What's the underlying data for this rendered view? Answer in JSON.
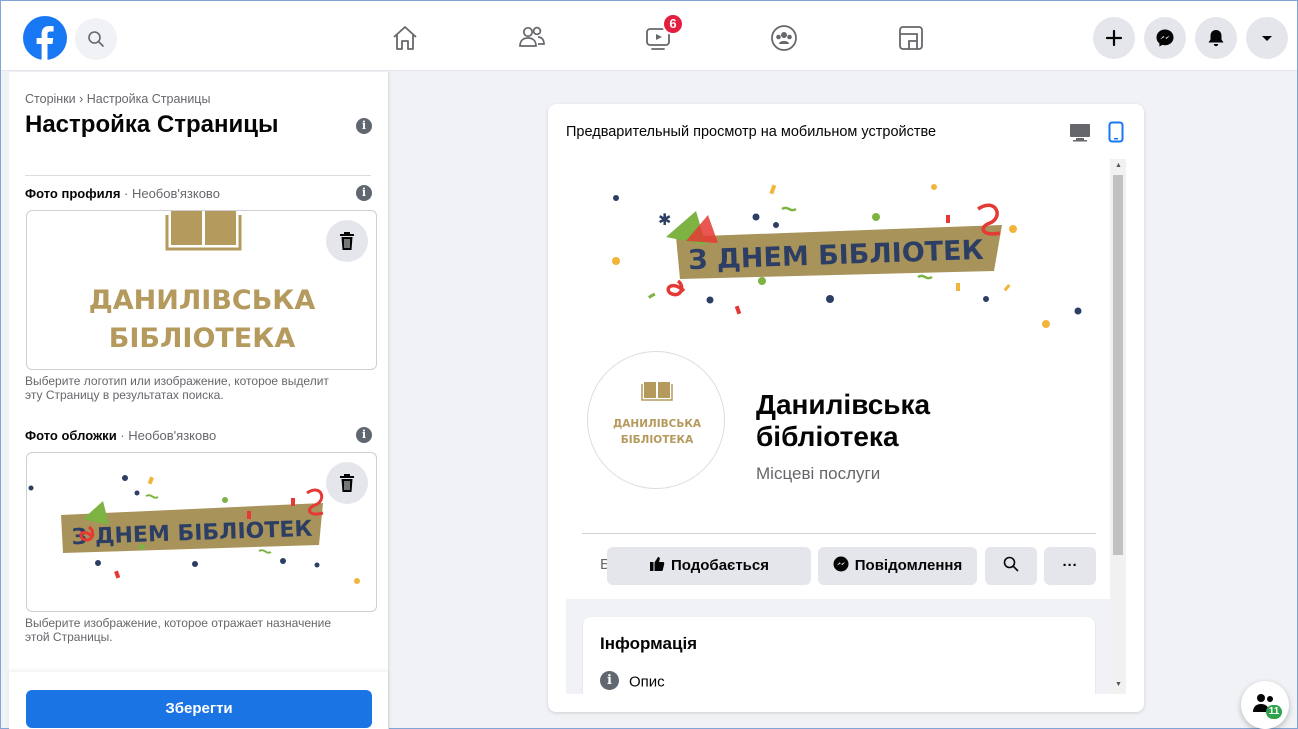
{
  "colors": {
    "brand": "#1877f2",
    "badge": "#e41e3f",
    "save_button": "#1b74e4",
    "online": "#31a24c",
    "logo_gold": "#b59a5e",
    "banner_tape": "#a8935a",
    "banner_text": "#2c3e64"
  },
  "topbar": {
    "logo_icon": "facebook-logo",
    "search_icon": "search-icon",
    "nav": [
      {
        "icon": "home-icon"
      },
      {
        "icon": "friends-icon"
      },
      {
        "icon": "watch-icon",
        "badge": "6"
      },
      {
        "icon": "groups-icon"
      },
      {
        "icon": "gaming-icon"
      }
    ],
    "actions": [
      {
        "icon": "plus-icon"
      },
      {
        "icon": "messenger-icon"
      },
      {
        "icon": "bell-icon"
      },
      {
        "icon": "caret-down-icon"
      }
    ]
  },
  "left": {
    "breadcrumb": "Сторінки › Настройка Страницы",
    "title": "Настройка Страницы",
    "profile_photo": {
      "label": "Фото профиля",
      "optional": " · Необов'язково",
      "logo_line1": "ДАНИЛІВСЬКА",
      "logo_line2": "БІБЛІОТЕКА",
      "helper": "Выберите логотип или изображение, которое выделит эту Страницу в результатах поиска."
    },
    "cover_photo": {
      "label": "Фото обложки",
      "optional": " · Необов'язково",
      "banner_text": "З ДНЕМ БІБЛІОТЕК",
      "helper": "Выберите изображение, которое отражает назначение этой Страницы."
    },
    "save_label": "Зберегти"
  },
  "preview": {
    "title": "Предварительный просмотр на мобильном устройстве",
    "banner_text": "З ДНЕМ БІБЛІОТЕК",
    "avatar_line1": "ДАНИЛІВСЬКА",
    "avatar_line2": "БІБЛІОТЕКА",
    "page_name": "Данилівська бібліотека",
    "category": "Місцеві послуги",
    "tab_stub": "Б",
    "like_label": "Подобається",
    "message_label": "Повідомлення",
    "more_label": "···",
    "info_title": "Інформація",
    "info_row": "Опис",
    "info_icon": "i"
  },
  "contacts": {
    "count": "11"
  }
}
